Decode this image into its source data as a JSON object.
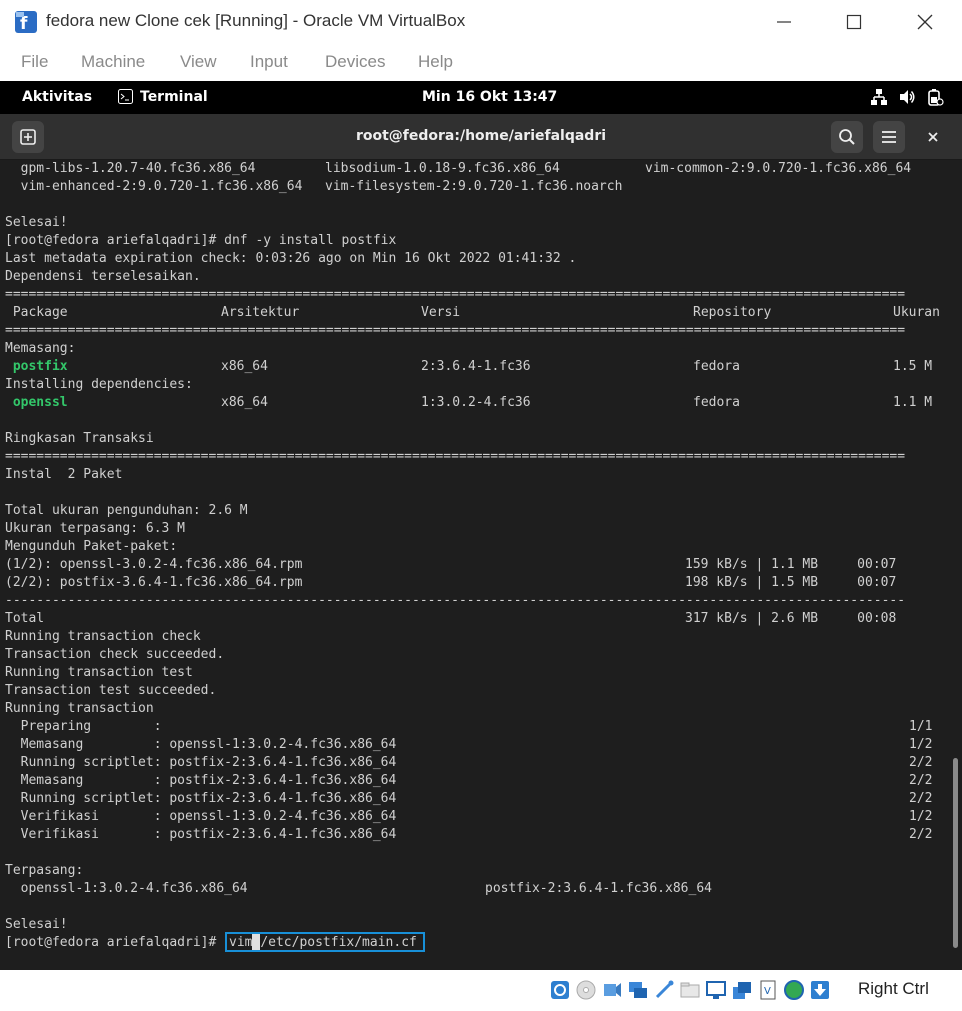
{
  "window": {
    "title": "fedora new Clone cek [Running] - Oracle VM VirtualBox"
  },
  "menu": [
    "File",
    "Machine",
    "View",
    "Input",
    "Devices",
    "Help"
  ],
  "gnome_bar": {
    "activities": "Aktivitas",
    "app": "Terminal",
    "clock": "Min 16 Okt  13:47"
  },
  "terminal": {
    "title": "root@fedora:/home/ariefalqadri",
    "lines": [
      {
        "cols": [
          [
            "  gpm-libs-1.20.7-40.fc36.x86_64",
            0
          ],
          [
            "libsodium-1.0.18-9.fc36.x86_64",
            40
          ],
          [
            "vim-common-2:9.0.720-1.fc36.x86_64",
            80
          ]
        ]
      },
      {
        "cols": [
          [
            "  vim-enhanced-2:9.0.720-1.fc36.x86_64",
            0
          ],
          [
            "vim-filesystem-2:9.0.720-1.fc36.noarch",
            40
          ]
        ]
      },
      {
        "cols": []
      },
      {
        "cols": [
          [
            "Selesai!",
            0
          ]
        ]
      },
      {
        "cols": [
          [
            "[root@fedora ariefalqadri]# dnf -y install postfix",
            0
          ]
        ]
      },
      {
        "cols": [
          [
            "Last metadata expiration check: 0:03:26 ago on Min 16 Okt 2022 01:41:32 .",
            0
          ]
        ]
      },
      {
        "cols": [
          [
            "Dependensi terselesaikan.",
            0
          ]
        ]
      },
      {
        "cols": [
          [
            "===================================================================================================================",
            0
          ]
        ]
      },
      {
        "cols": [
          [
            " Package",
            0
          ],
          [
            "Arsitektur",
            27
          ],
          [
            "Versi",
            52
          ],
          [
            "Repository",
            86
          ],
          [
            "Ukuran",
            111
          ]
        ]
      },
      {
        "cols": [
          [
            "===================================================================================================================",
            0
          ]
        ]
      },
      {
        "cols": [
          [
            "Memasang:",
            0
          ]
        ]
      },
      {
        "cols": [
          [
            " postfix",
            0,
            "g"
          ],
          [
            "x86_64",
            27
          ],
          [
            "2:3.6.4-1.fc36",
            52
          ],
          [
            "fedora",
            86
          ],
          [
            "1.5 M",
            111
          ]
        ]
      },
      {
        "cols": [
          [
            "Installing dependencies:",
            0
          ]
        ]
      },
      {
        "cols": [
          [
            " openssl",
            0,
            "g"
          ],
          [
            "x86_64",
            27
          ],
          [
            "1:3.0.2-4.fc36",
            52
          ],
          [
            "fedora",
            86
          ],
          [
            "1.1 M",
            111
          ]
        ]
      },
      {
        "cols": []
      },
      {
        "cols": [
          [
            "Ringkasan Transaksi",
            0
          ]
        ]
      },
      {
        "cols": [
          [
            "===================================================================================================================",
            0
          ]
        ]
      },
      {
        "cols": [
          [
            "Instal  2 Paket",
            0
          ]
        ]
      },
      {
        "cols": []
      },
      {
        "cols": [
          [
            "Total ukuran pengunduhan: 2.6 M",
            0
          ]
        ]
      },
      {
        "cols": [
          [
            "Ukuran terpasang: 6.3 M",
            0
          ]
        ]
      },
      {
        "cols": [
          [
            "Mengunduh Paket-paket:",
            0
          ]
        ]
      },
      {
        "cols": [
          [
            "(1/2): openssl-3.0.2-4.fc36.x86_64.rpm",
            0
          ],
          [
            "159 kB/s | 1.1 MB     00:07",
            85
          ]
        ]
      },
      {
        "cols": [
          [
            "(2/2): postfix-3.6.4-1.fc36.x86_64.rpm",
            0
          ],
          [
            "198 kB/s | 1.5 MB     00:07",
            85
          ]
        ]
      },
      {
        "cols": [
          [
            "-------------------------------------------------------------------------------------------------------------------",
            0
          ]
        ]
      },
      {
        "cols": [
          [
            "Total",
            0
          ],
          [
            "317 kB/s | 2.6 MB     00:08",
            85
          ]
        ]
      },
      {
        "cols": [
          [
            "Running transaction check",
            0
          ]
        ]
      },
      {
        "cols": [
          [
            "Transaction check succeeded.",
            0
          ]
        ]
      },
      {
        "cols": [
          [
            "Running transaction test",
            0
          ]
        ]
      },
      {
        "cols": [
          [
            "Transaction test succeeded.",
            0
          ]
        ]
      },
      {
        "cols": [
          [
            "Running transaction",
            0
          ]
        ]
      },
      {
        "cols": [
          [
            "  Preparing        :",
            0
          ],
          [
            "1/1",
            113
          ]
        ]
      },
      {
        "cols": [
          [
            "  Memasang         : openssl-1:3.0.2-4.fc36.x86_64",
            0
          ],
          [
            "1/2",
            113
          ]
        ]
      },
      {
        "cols": [
          [
            "  Running scriptlet: postfix-2:3.6.4-1.fc36.x86_64",
            0
          ],
          [
            "2/2",
            113
          ]
        ]
      },
      {
        "cols": [
          [
            "  Memasang         : postfix-2:3.6.4-1.fc36.x86_64",
            0
          ],
          [
            "2/2",
            113
          ]
        ]
      },
      {
        "cols": [
          [
            "  Running scriptlet: postfix-2:3.6.4-1.fc36.x86_64",
            0
          ],
          [
            "2/2",
            113
          ]
        ]
      },
      {
        "cols": [
          [
            "  Verifikasi       : openssl-1:3.0.2-4.fc36.x86_64",
            0
          ],
          [
            "1/2",
            113
          ]
        ]
      },
      {
        "cols": [
          [
            "  Verifikasi       : postfix-2:3.6.4-1.fc36.x86_64",
            0
          ],
          [
            "2/2",
            113
          ]
        ]
      },
      {
        "cols": []
      },
      {
        "cols": [
          [
            "Terpasang:",
            0
          ]
        ]
      },
      {
        "cols": [
          [
            "  openssl-1:3.0.2-4.fc36.x86_64",
            0
          ],
          [
            "postfix-2:3.6.4-1.fc36.x86_64",
            60
          ]
        ]
      },
      {
        "cols": []
      },
      {
        "cols": [
          [
            "Selesai!",
            0
          ]
        ]
      }
    ],
    "prompt": "[root@fedora ariefalqadri]# ",
    "command_before_cursor": "vim",
    "command_at_cursor": " ",
    "command_after_cursor": "/etc/postfix/main.cf"
  },
  "statusbar": {
    "host_key": "Right Ctrl"
  }
}
